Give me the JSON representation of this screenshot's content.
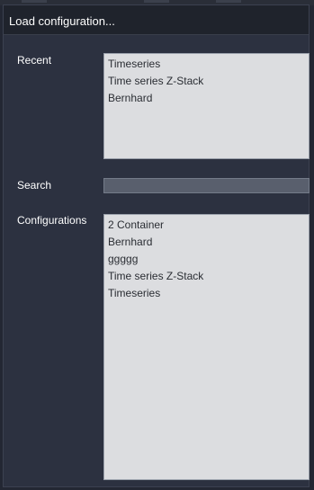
{
  "header": {
    "title": "Load configuration..."
  },
  "recent": {
    "label": "Recent",
    "items": [
      "Timeseries",
      "Time series Z-Stack",
      "Bernhard"
    ]
  },
  "search": {
    "label": "Search",
    "value": ""
  },
  "configurations": {
    "label": "Configurations",
    "items": [
      "2 Container",
      "Bernhard",
      "ggggg",
      "Time series Z-Stack",
      "Timeseries"
    ]
  }
}
